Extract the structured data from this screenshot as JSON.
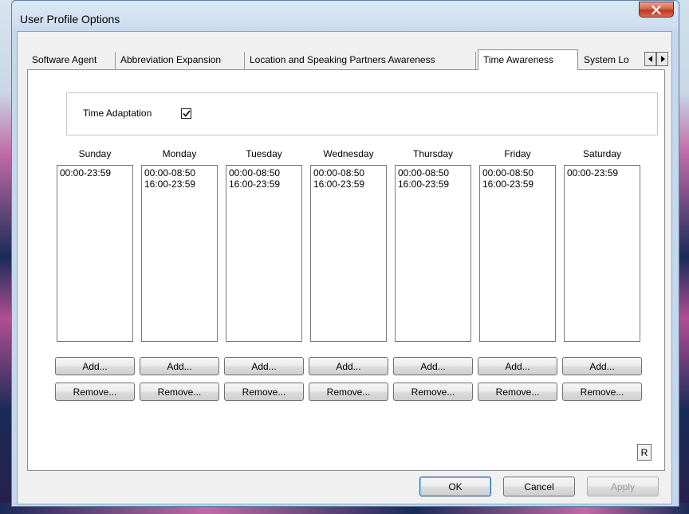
{
  "window": {
    "title": "User Profile Options"
  },
  "tabs": [
    {
      "label": "Software Agent",
      "selected": false
    },
    {
      "label": "Abbreviation Expansion",
      "selected": false
    },
    {
      "label": "Location and Speaking Partners Awareness",
      "selected": false
    },
    {
      "label": "Time Awareness",
      "selected": true
    },
    {
      "label": "System Lo",
      "selected": false
    }
  ],
  "time_adaptation": {
    "label": "Time Adaptation",
    "checked": true
  },
  "days": [
    {
      "name": "Sunday",
      "entries": [
        "00:00-23:59"
      ]
    },
    {
      "name": "Monday",
      "entries": [
        "00:00-08:50",
        "16:00-23:59"
      ]
    },
    {
      "name": "Tuesday",
      "entries": [
        "00:00-08:50",
        "16:00-23:59"
      ]
    },
    {
      "name": "Wednesday",
      "entries": [
        "00:00-08:50",
        "16:00-23:59"
      ]
    },
    {
      "name": "Thursday",
      "entries": [
        "00:00-08:50",
        "16:00-23:59"
      ]
    },
    {
      "name": "Friday",
      "entries": [
        "00:00-08:50",
        "16:00-23:59"
      ]
    },
    {
      "name": "Saturday",
      "entries": [
        "00:00-23:59"
      ]
    }
  ],
  "buttons": {
    "add_label": "Add...",
    "remove_label": "Remove...",
    "r_label": "R",
    "ok_label": "OK",
    "cancel_label": "Cancel",
    "apply_label": "Apply"
  }
}
